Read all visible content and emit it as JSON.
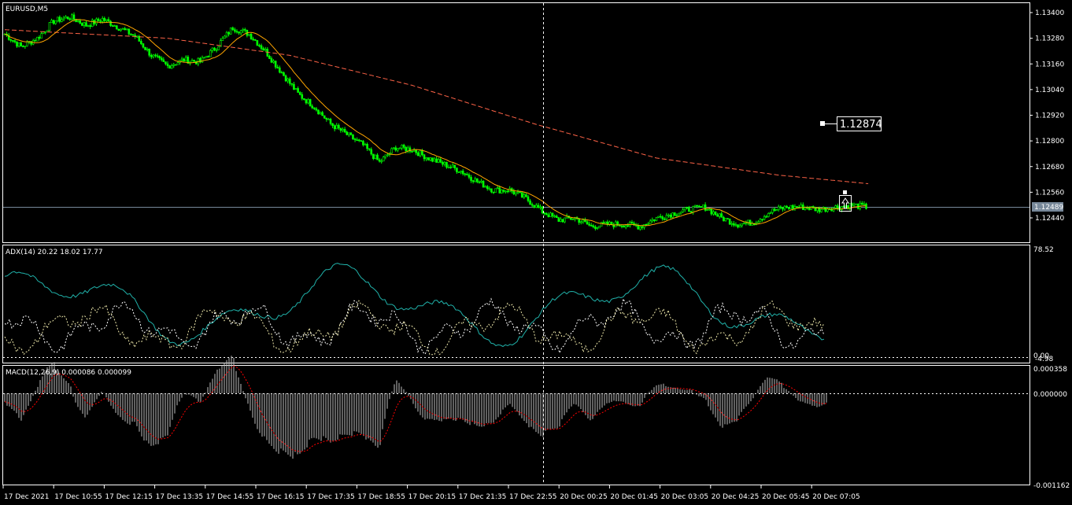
{
  "main_panel": {
    "symbol_label": "EURUSD,M5",
    "price_ticks": [
      "1.13400",
      "1.13280",
      "1.13160",
      "1.13040",
      "1.12920",
      "1.12800",
      "1.12680",
      "1.12560",
      "1.12440"
    ],
    "current_price_label": "1.12489",
    "marker_price_label": "1.12874"
  },
  "adx_panel": {
    "label": "ADX(14) 20.22 18.02 17.77",
    "ticks": [
      "78.52",
      "0.00"
    ],
    "overlap_tick": "-4.98"
  },
  "macd_panel": {
    "label": "MACD(12,26,9) 0.000086 0.000099",
    "ticks": [
      "0.000358",
      "0.000000",
      "-0.001162"
    ]
  },
  "time_axis": [
    "17 Dec 2021",
    "17 Dec 10:55",
    "17 Dec 12:15",
    "17 Dec 13:35",
    "17 Dec 14:55",
    "17 Dec 16:15",
    "17 Dec 17:35",
    "17 Dec 18:55",
    "17 Dec 20:15",
    "17 Dec 21:35",
    "17 Dec 22:55",
    "20 Dec 00:25",
    "20 Dec 01:45",
    "20 Dec 03:05",
    "20 Dec 04:25",
    "20 Dec 05:45",
    "20 Dec 07:05"
  ],
  "colors": {
    "background": "#000000",
    "frame": "#ffffff",
    "candle": "#00ff00",
    "ma_fast": "#ffa500",
    "ma_slow": "#ff6347",
    "adx_main": "#20b2aa",
    "adx_plus": "#ffffff",
    "adx_minus": "#eee8aa",
    "macd_hist": "#c0c0c0",
    "macd_signal": "#ff0000",
    "crosshair": "#ffffff",
    "price_line": "#778899"
  },
  "chart_data": {
    "type": "candlestick",
    "symbol": "EURUSD",
    "timeframe": "M5",
    "price_range": [
      1.1238,
      1.1344
    ],
    "close_path": [
      [
        0,
        1.133
      ],
      [
        2,
        1.1324
      ],
      [
        4,
        1.1328
      ],
      [
        6,
        1.1336
      ],
      [
        8,
        1.1338
      ],
      [
        10,
        1.1334
      ],
      [
        12,
        1.1337
      ],
      [
        14,
        1.1333
      ],
      [
        16,
        1.1329
      ],
      [
        18,
        1.132
      ],
      [
        20,
        1.1315
      ],
      [
        22,
        1.1318
      ],
      [
        24,
        1.1317
      ],
      [
        26,
        1.1324
      ],
      [
        28,
        1.1333
      ],
      [
        30,
        1.133
      ],
      [
        32,
        1.1322
      ],
      [
        34,
        1.1312
      ],
      [
        36,
        1.1302
      ],
      [
        38,
        1.1296
      ],
      [
        40,
        1.1288
      ],
      [
        42,
        1.1283
      ],
      [
        44,
        1.1278
      ],
      [
        46,
        1.127
      ],
      [
        48,
        1.1277
      ],
      [
        50,
        1.1276
      ],
      [
        52,
        1.1272
      ],
      [
        54,
        1.1269
      ],
      [
        56,
        1.1266
      ],
      [
        58,
        1.1261
      ],
      [
        60,
        1.1257
      ],
      [
        62,
        1.1257
      ],
      [
        64,
        1.1253
      ],
      [
        66,
        1.1247
      ],
      [
        68,
        1.1243
      ],
      [
        70,
        1.1244
      ],
      [
        72,
        1.124
      ],
      [
        74,
        1.1241
      ],
      [
        76,
        1.1241
      ],
      [
        78,
        1.124
      ],
      [
        80,
        1.1244
      ],
      [
        82,
        1.1246
      ],
      [
        84,
        1.1248
      ],
      [
        86,
        1.1249
      ],
      [
        88,
        1.1244
      ],
      [
        90,
        1.1241
      ],
      [
        92,
        1.1242
      ],
      [
        94,
        1.1247
      ],
      [
        96,
        1.1249
      ],
      [
        98,
        1.1249
      ],
      [
        100,
        1.1248
      ],
      [
        102,
        1.1249
      ],
      [
        104,
        1.125
      ],
      [
        106,
        1.1249
      ]
    ],
    "current_price": 1.12489,
    "marked_price": 1.12874,
    "adx": {
      "adx": 20.22,
      "plus_di": 18.02,
      "minus_di": 17.77,
      "range": [
        0.0,
        78.52
      ]
    },
    "macd": {
      "main": 8.6e-05,
      "signal": 9.9e-05,
      "range": [
        -0.001162,
        0.000358
      ]
    }
  }
}
